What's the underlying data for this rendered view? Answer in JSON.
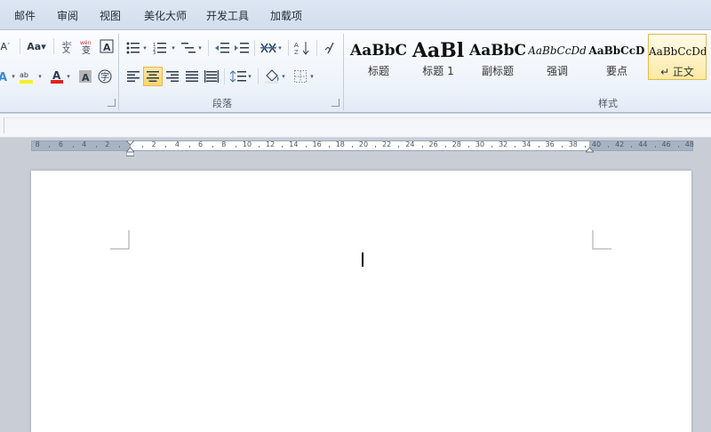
{
  "tabs": [
    "邮件",
    "审阅",
    "视图",
    "美化大师",
    "开发工具",
    "加载项"
  ],
  "groups": {
    "paragraph": "段落",
    "styles": "样式"
  },
  "styles": [
    {
      "sample": "AaBbC",
      "name": "标题",
      "weight": "bold",
      "size": 17,
      "family": "serif",
      "italic": false
    },
    {
      "sample": "AaBl",
      "name": "标题 1",
      "weight": "bold",
      "size": 22,
      "family": "serif",
      "italic": false
    },
    {
      "sample": "AaBbC",
      "name": "副标题",
      "weight": "bold",
      "size": 17,
      "family": "serif",
      "italic": false
    },
    {
      "sample": "AaBbCcDd",
      "name": "强调",
      "weight": "normal",
      "size": 12,
      "family": "serif",
      "italic": true
    },
    {
      "sample": "AaBbCcD",
      "name": "要点",
      "weight": "bold",
      "size": 12,
      "family": "serif",
      "italic": false
    },
    {
      "sample": "AaBbCcDd",
      "name": "↵ 正文",
      "weight": "normal",
      "size": 12,
      "family": "serif",
      "italic": false
    }
  ],
  "ruler": {
    "left_labels": [
      "8",
      "6",
      "4",
      "2"
    ],
    "right_labels": [
      "2",
      "4",
      "6",
      "8",
      "10",
      "12",
      "14",
      "16",
      "18",
      "20",
      "22",
      "24",
      "26",
      "28",
      "30",
      "32",
      "34",
      "36",
      "38",
      "40",
      "42",
      "44",
      "46",
      "48"
    ]
  },
  "colors": {
    "accent": "#fcd46c",
    "font_red": "#e0211b",
    "highlight_yellow": "#f6ef2a"
  }
}
